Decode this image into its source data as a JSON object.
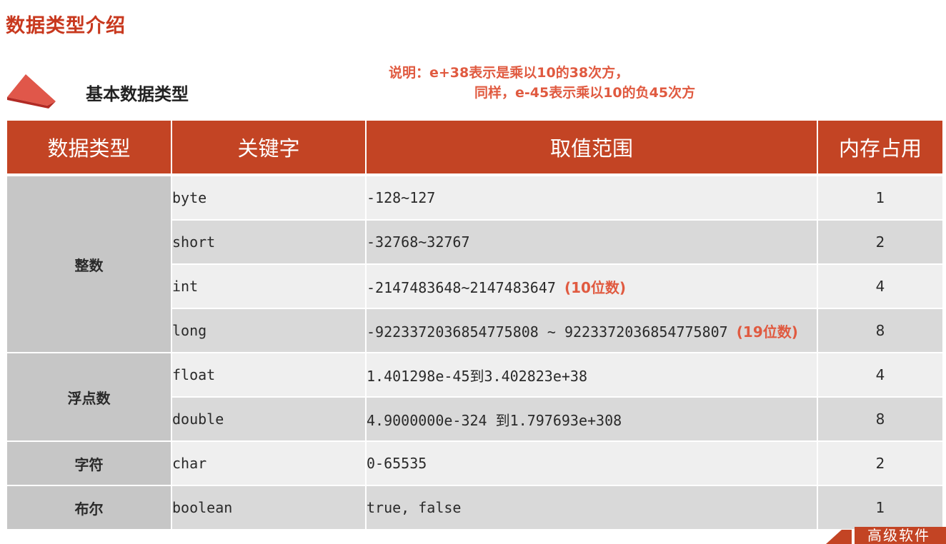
{
  "title": "数据类型介绍",
  "section": {
    "icon": "red-triangle-icon",
    "label": "基本数据类型"
  },
  "note": {
    "line1": "说明：e+38表示是乘以10的38次方，",
    "line2": "同样，e-45表示乘以10的负45次方"
  },
  "table": {
    "headers": [
      "数据类型",
      "关键字",
      "取值范围",
      "内存占用"
    ],
    "categories": {
      "integer": "整数",
      "float": "浮点数",
      "char": "字符",
      "bool": "布尔"
    },
    "rows": [
      {
        "keyword": "byte",
        "range": "-128~127",
        "note": "",
        "memory": "1"
      },
      {
        "keyword": "short",
        "range": "-32768~32767",
        "note": "",
        "memory": "2"
      },
      {
        "keyword": "int",
        "range": "-2147483648~2147483647 ",
        "note": "(10位数)",
        "memory": "4"
      },
      {
        "keyword": "long",
        "range": "-9223372036854775808 ~ 9223372036854775807 ",
        "note": "(19位数)",
        "memory": "8"
      },
      {
        "keyword": "float",
        "range": "1.401298e-45到3.402823e+38",
        "note": "",
        "memory": "4"
      },
      {
        "keyword": "double",
        "range": "4.9000000e-324 到1.797693e+308",
        "note": "",
        "memory": "8"
      },
      {
        "keyword": "char",
        "range": "0-65535",
        "note": "",
        "memory": "2"
      },
      {
        "keyword": "boolean",
        "range": "true, false",
        "note": "",
        "memory": "1"
      }
    ]
  },
  "footer": {
    "label": "高级软件"
  },
  "colors": {
    "accent": "#c34424",
    "note": "#e05a40",
    "title": "#c8381e"
  }
}
